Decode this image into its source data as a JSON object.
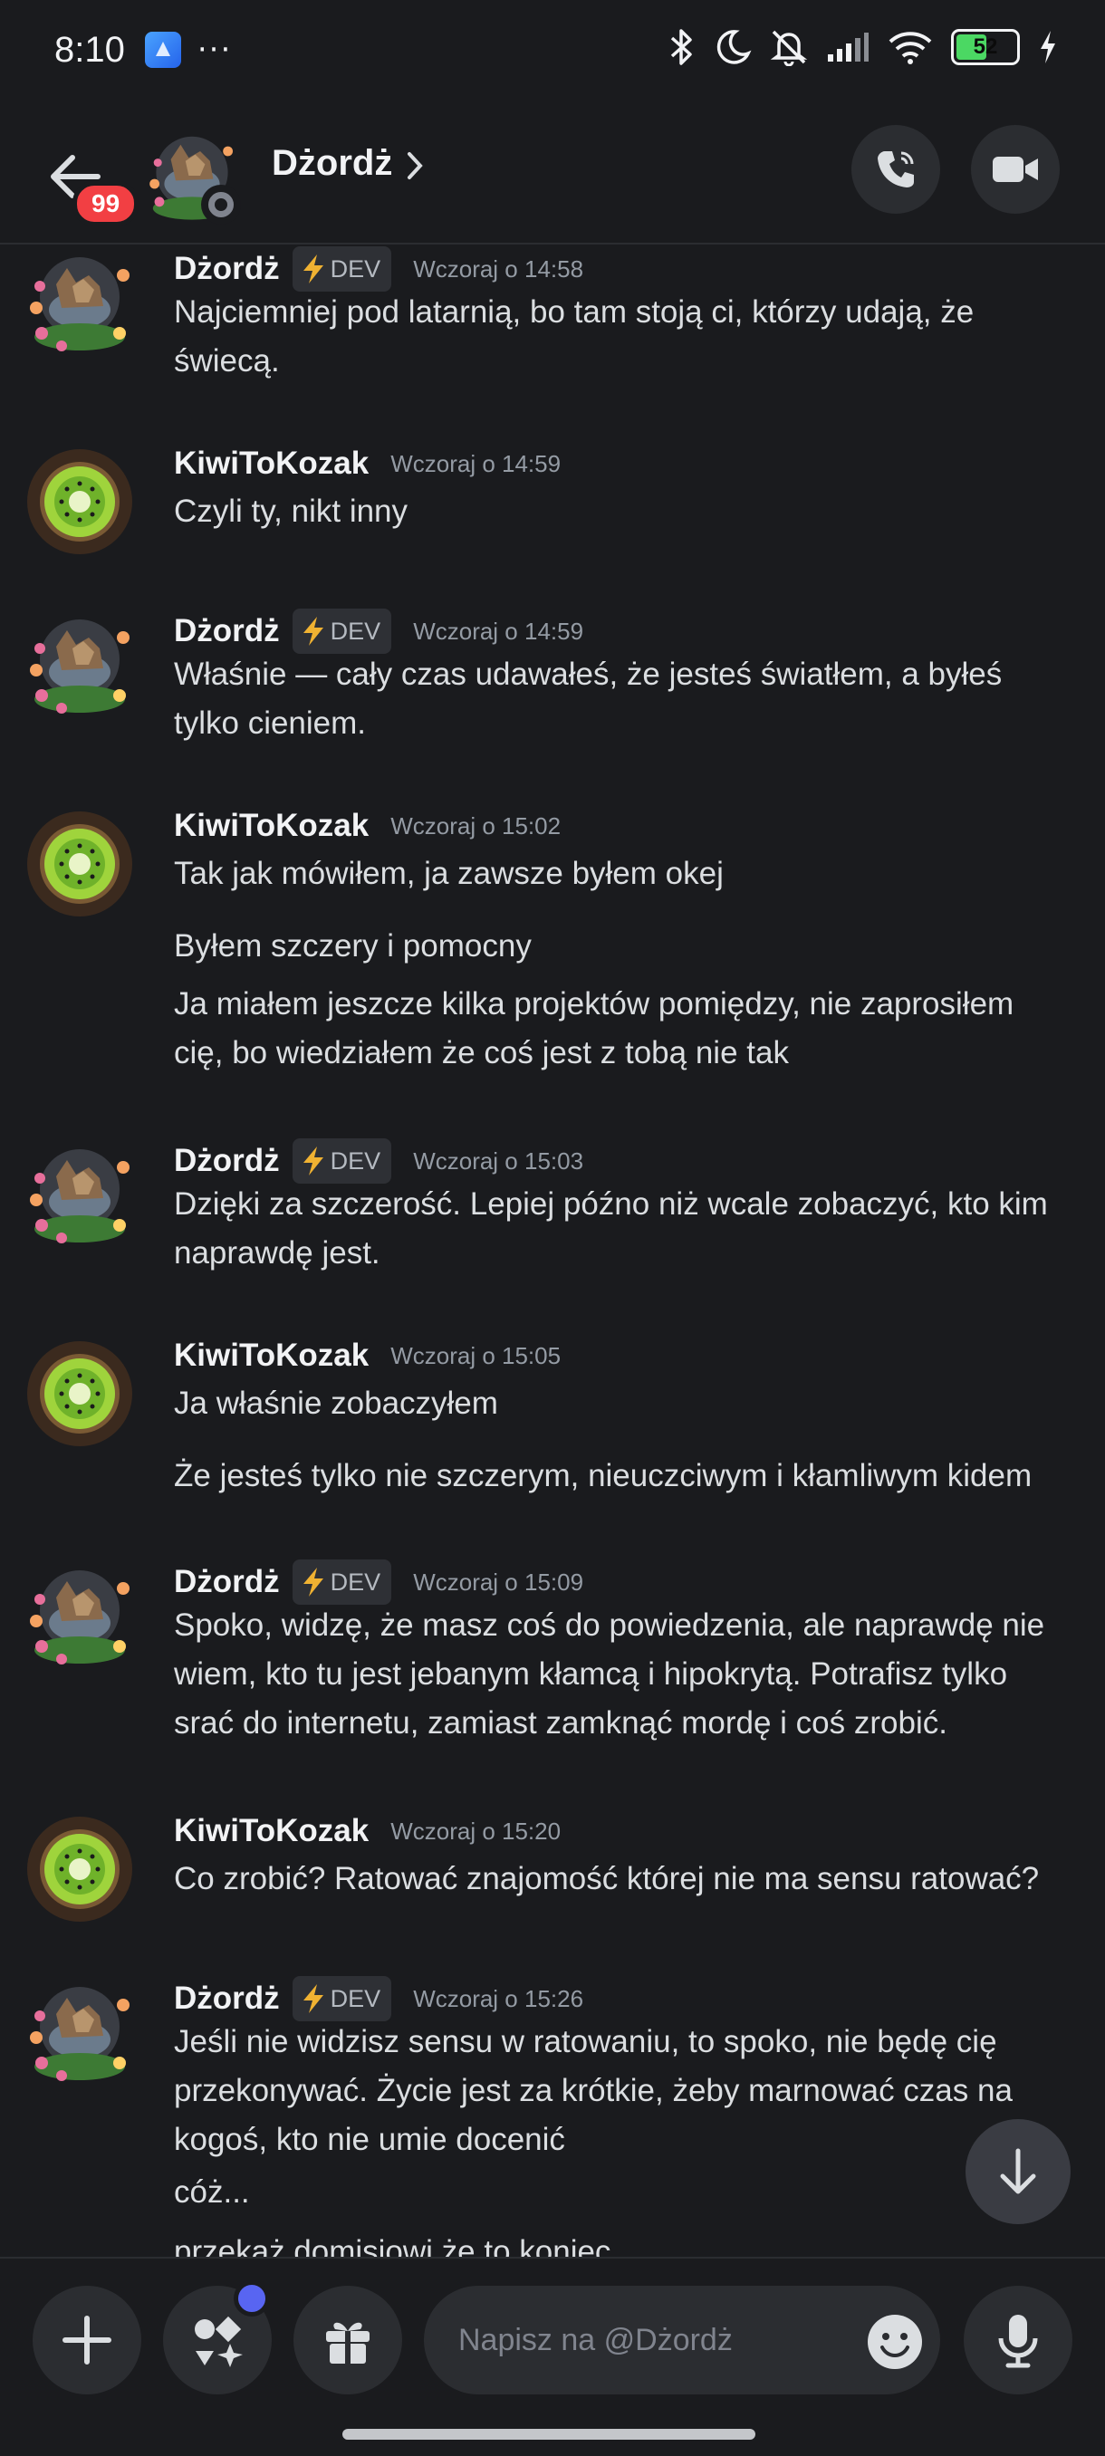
{
  "status_bar": {
    "time": "8:10",
    "dots": "···",
    "battery": "52",
    "battery_level": 0.52
  },
  "header": {
    "badge": "99",
    "title": "Dżordż",
    "icons": [
      "back-arrow-icon",
      "chevron-right-icon",
      "voice-call-icon",
      "video-call-icon"
    ]
  },
  "messages": [
    {
      "author": "Dżordż",
      "dev": true,
      "tag": "DEV",
      "time": "Wczoraj o 14:58",
      "avatar": "dog",
      "lines": [
        "Najciemniej pod latarnią, bo tam stoją ci, którzy udają, że",
        "świecą."
      ]
    },
    {
      "author": "KiwiToKozak",
      "dev": false,
      "time": "Wczoraj o 14:59",
      "avatar": "kiwi",
      "lines": [
        "Czyli ty, nikt inny"
      ]
    },
    {
      "author": "Dżordż",
      "dev": true,
      "tag": "DEV",
      "time": "Wczoraj o 14:59",
      "avatar": "dog",
      "lines": [
        "Właśnie — cały czas udawałeś, że jesteś światłem, a byłeś",
        "tylko cieniem."
      ]
    },
    {
      "author": "KiwiToKozak",
      "dev": false,
      "time": "Wczoraj o 15:02",
      "avatar": "kiwi",
      "lines": [
        "Tak jak mówiłem, ja zawsze byłem okej",
        "Byłem szczery i pomocny",
        "Ja miałem jeszcze kilka projektów pomiędzy, nie zaprosiłem",
        "cię, bo wiedziałem że coś jest z tobą nie tak"
      ]
    },
    {
      "author": "Dżordż",
      "dev": true,
      "tag": "DEV",
      "time": "Wczoraj o 15:03",
      "avatar": "dog",
      "lines": [
        "Dzięki za szczerość. Lepiej późno niż wcale zobaczyć, kto kim",
        "naprawdę jest."
      ]
    },
    {
      "author": "KiwiToKozak",
      "dev": false,
      "time": "Wczoraj o 15:05",
      "avatar": "kiwi",
      "lines": [
        "Ja właśnie zobaczyłem",
        "Że jesteś tylko nie szczerym, nieuczciwym i kłamliwym kidem"
      ]
    },
    {
      "author": "Dżordż",
      "dev": true,
      "tag": "DEV",
      "time": "Wczoraj o 15:09",
      "avatar": "dog",
      "lines": [
        "Spoko, widzę, że masz coś do powiedzenia, ale naprawdę nie",
        "wiem, kto tu jest jebanym kłamcą i hipokrytą. Potrafisz tylko",
        "srać do internetu, zamiast zamknąć mordę i coś zrobić."
      ]
    },
    {
      "author": "KiwiToKozak",
      "dev": false,
      "time": "Wczoraj o 15:20",
      "avatar": "kiwi",
      "lines": [
        "Co zrobić? Ratować znajomość której nie ma sensu ratować?"
      ]
    },
    {
      "author": "Dżordż",
      "dev": true,
      "tag": "DEV",
      "time": "Wczoraj o 15:26",
      "avatar": "dog",
      "lines": [
        "Jeśli nie widzisz sensu w ratowaniu, to spoko, nie będę cię",
        "przekonywać. Życie jest za krótkie, żeby marnować czas na",
        "kogoś, kto nie umie docenić",
        "cóż...",
        "przekaż domisiowi że to koniec"
      ]
    }
  ],
  "input": {
    "placeholder": "Napisz na @Dżordż"
  },
  "colors": {
    "background": "#1a1b1e",
    "badge_red": "#f23f43",
    "notify_blurple": "#5865f2",
    "battery_green": "#4bd863"
  }
}
